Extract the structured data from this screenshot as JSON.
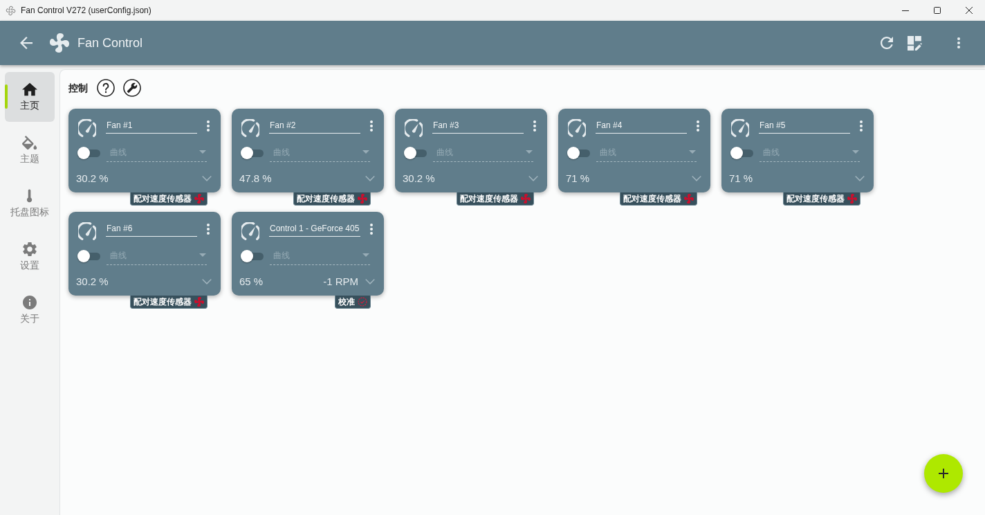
{
  "window": {
    "title": "Fan Control V272 (userConfig.json)"
  },
  "app_bar": {
    "title": "Fan Control"
  },
  "sidebar": {
    "items": [
      {
        "label": "主页",
        "selected": true
      },
      {
        "label": "主题",
        "selected": false
      },
      {
        "label": "托盘图标",
        "selected": false
      },
      {
        "label": "设置",
        "selected": false
      },
      {
        "label": "关于",
        "selected": false
      }
    ]
  },
  "section": {
    "title": "控制"
  },
  "cards": [
    {
      "name": "Fan #1",
      "on": false,
      "mode": {
        "placeholder": "曲线"
      },
      "value": "30.2 %",
      "badge": {
        "kind": "pair",
        "text": "配对速度传感器"
      }
    },
    {
      "name": "Fan #2",
      "on": false,
      "mode": {
        "placeholder": "曲线"
      },
      "value": "47.8 %",
      "badge": {
        "kind": "pair",
        "text": "配对速度传感器"
      }
    },
    {
      "name": "Fan #3",
      "on": false,
      "mode": {
        "placeholder": "曲线"
      },
      "value": "30.2 %",
      "badge": {
        "kind": "pair",
        "text": "配对速度传感器"
      }
    },
    {
      "name": "Fan #4",
      "on": false,
      "mode": {
        "placeholder": "曲线"
      },
      "value": "71 %",
      "badge": {
        "kind": "pair",
        "text": "配对速度传感器"
      }
    },
    {
      "name": "Fan #5",
      "on": false,
      "mode": {
        "placeholder": "曲线"
      },
      "value": "71 %",
      "badge": {
        "kind": "pair",
        "text": "配对速度传感器"
      }
    },
    {
      "name": "Fan #6",
      "on": false,
      "mode": {
        "placeholder": "曲线"
      },
      "value": "30.2 %",
      "badge": {
        "kind": "pair",
        "text": "配对速度传感器"
      }
    },
    {
      "name": "Control 1 - GeForce 405",
      "on": false,
      "mode": {
        "placeholder": "曲线"
      },
      "value": "65 %",
      "rpm": "-1 RPM",
      "badge": {
        "kind": "calibrate",
        "text": "校准"
      }
    }
  ]
}
